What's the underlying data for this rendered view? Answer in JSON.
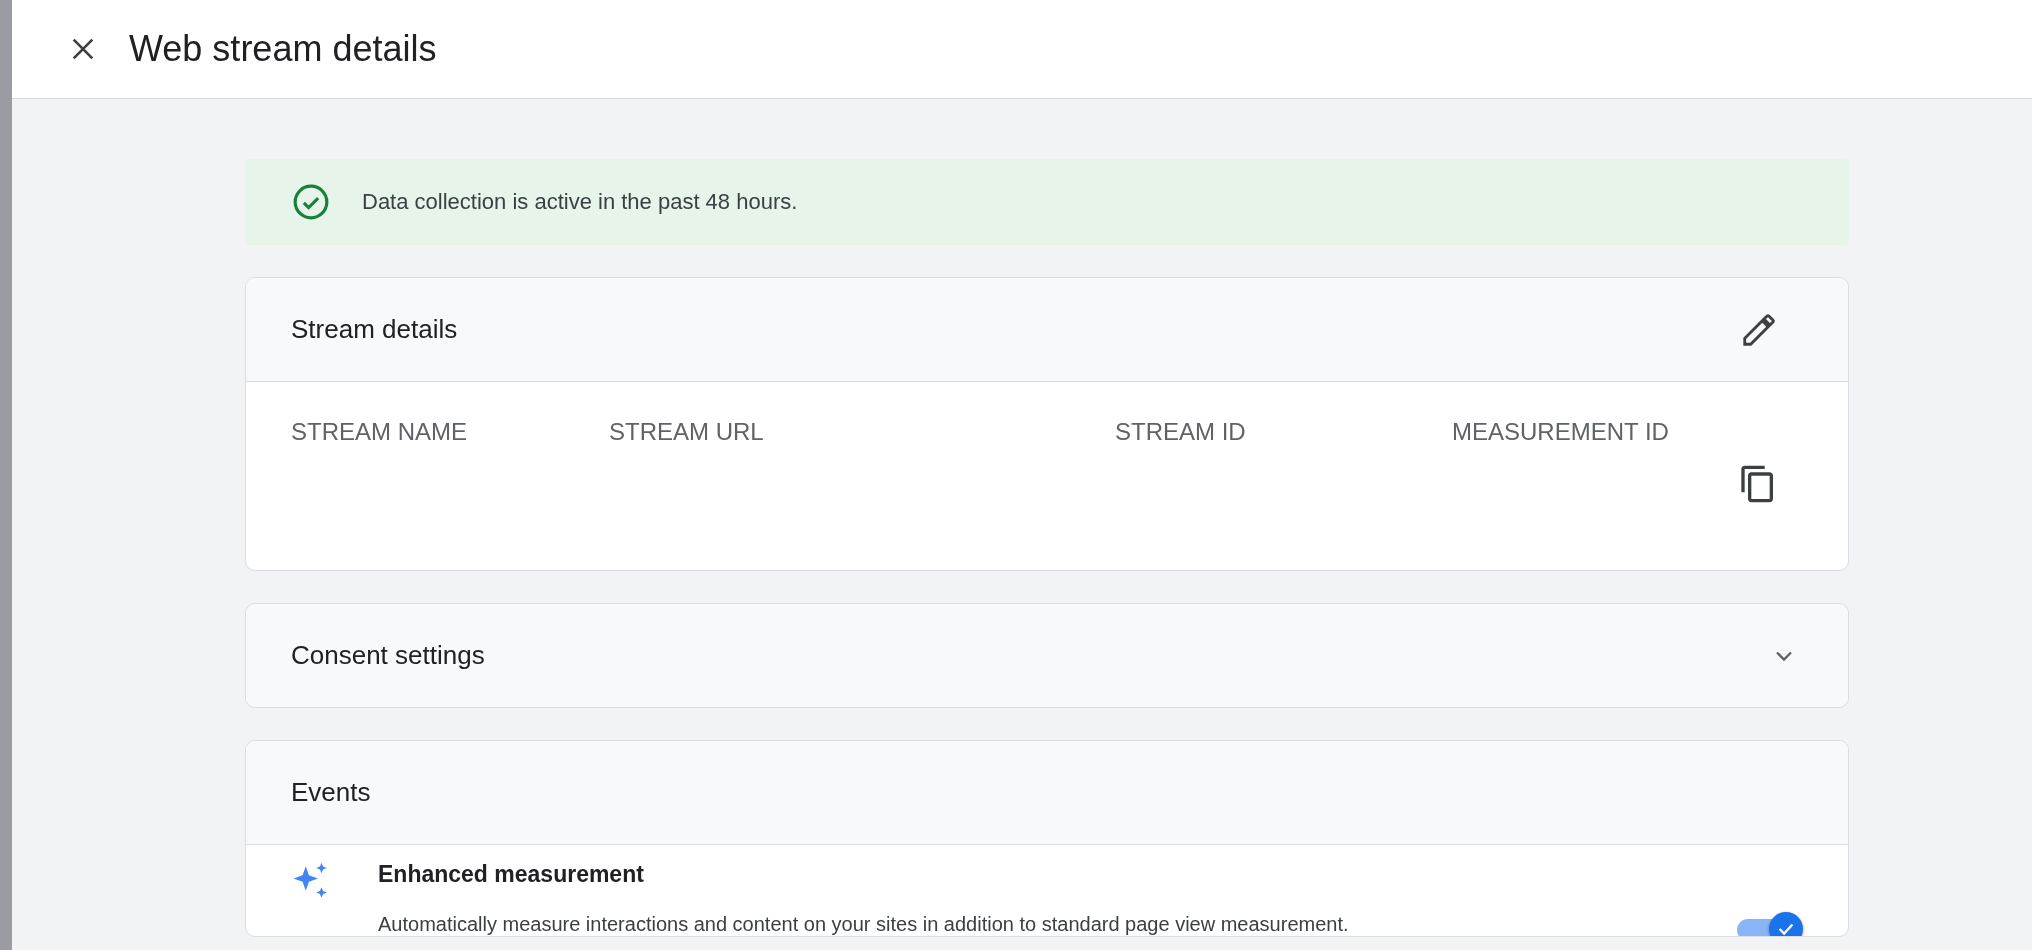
{
  "header": {
    "title": "Web stream details"
  },
  "banner": {
    "text": "Data collection is active in the past 48 hours."
  },
  "stream_details": {
    "title": "Stream details",
    "columns": [
      "STREAM NAME",
      "STREAM URL",
      "STREAM ID",
      "MEASUREMENT ID"
    ]
  },
  "consent_settings": {
    "title": "Consent settings",
    "expanded": false
  },
  "events": {
    "title": "Events",
    "items": [
      {
        "title": "Enhanced measurement",
        "description": "Automatically measure interactions and content on your sites in addition to standard page view measurement.",
        "on": true
      }
    ]
  }
}
